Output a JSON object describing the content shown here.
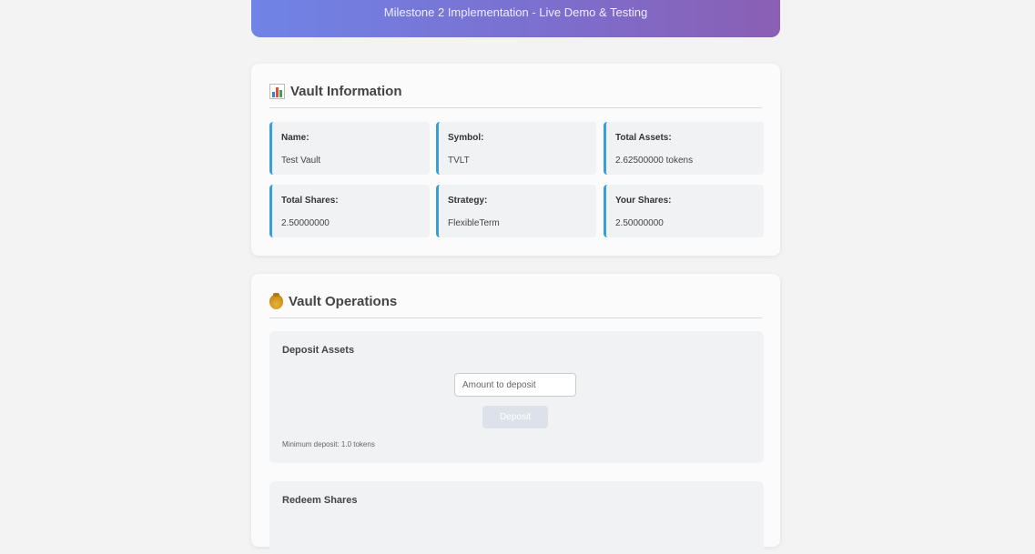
{
  "header": {
    "subtitle": "Milestone 2 Implementation - Live Demo & Testing"
  },
  "vault_info": {
    "title": "Vault Information",
    "icon": "bar-chart-icon",
    "fields": [
      {
        "label": "Name:",
        "value": "Test Vault"
      },
      {
        "label": "Symbol:",
        "value": "TVLT"
      },
      {
        "label": "Total Assets:",
        "value": "2.62500000 tokens"
      },
      {
        "label": "Total Shares:",
        "value": "2.50000000"
      },
      {
        "label": "Strategy:",
        "value": "FlexibleTerm"
      },
      {
        "label": "Your Shares:",
        "value": "2.50000000"
      }
    ]
  },
  "operations": {
    "title": "Vault Operations",
    "icon": "money-bag-icon",
    "deposit": {
      "title": "Deposit Assets",
      "placeholder": "Amount to deposit",
      "button_label": "Deposit",
      "hint": "Minimum deposit: 1.0 tokens"
    },
    "redeem": {
      "title": "Redeem Shares"
    }
  },
  "colors": {
    "accent_border": "#3a9fd8",
    "header_gradient_start": "#6f84e6",
    "header_gradient_end": "#8a5fb3"
  }
}
